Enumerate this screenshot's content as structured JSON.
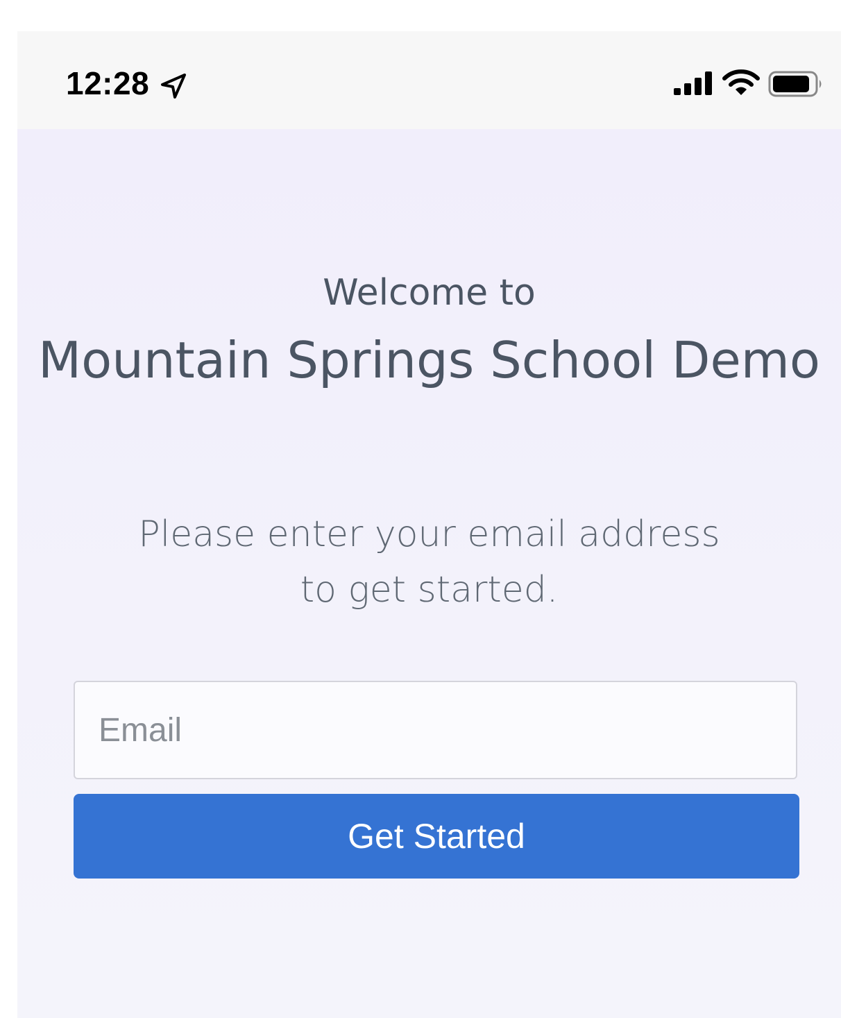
{
  "status_bar": {
    "time": "12:28",
    "icons": [
      "location-arrow-icon",
      "cellular-signal-icon",
      "wifi-icon",
      "battery-icon"
    ]
  },
  "welcome": {
    "greeting": "Welcome to",
    "school_name": "Mountain Springs School Demo"
  },
  "instructions": "Please enter your email address to get started.",
  "form": {
    "email_placeholder": "Email",
    "email_value": "",
    "submit_label": "Get Started"
  },
  "colors": {
    "accent": "#3573d3",
    "text": "#4b5563",
    "background": "#f2f0fb"
  }
}
